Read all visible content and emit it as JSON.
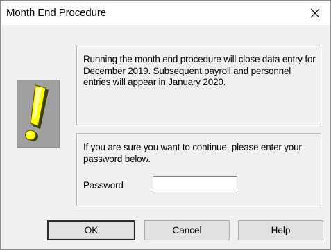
{
  "window": {
    "title": "Month End Procedure",
    "close_symbol": "×"
  },
  "icon": {
    "name": "exclamation-icon",
    "color": "#ffff00",
    "background": "#a0a0a0"
  },
  "message": {
    "text": "Running the month end procedure will close data entry for December 2019.  Subsequent payroll and personnel entries will appear in January 2020."
  },
  "password_section": {
    "prompt": "If you are sure you want to continue, please enter your password below.",
    "label": "Password",
    "value": "",
    "placeholder": ""
  },
  "buttons": {
    "ok": "OK",
    "cancel": "Cancel",
    "help": "Help"
  }
}
